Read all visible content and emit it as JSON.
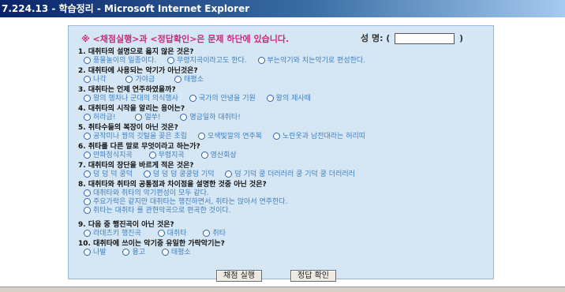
{
  "window": {
    "title": "7.224.13 - 학습정리 - Microsoft Internet Explorer"
  },
  "header": {
    "notice": "※ <채점실행>과 <정답확인>은 문제 하단에 있습니다.",
    "name_label": "성 명: (",
    "name_value": "",
    "name_close": ")"
  },
  "questions": [
    {
      "text": "1. 대취타의 설명으로 옳지 않은 것은?",
      "options": [
        "풍물놀이의 일종이다.",
        "무령지곡이라고도 한다.",
        "부는악기와 치는악기로 편성한다."
      ]
    },
    {
      "text": "2. 대취타에 사용되는 악기가 아닌것은?",
      "options": [
        "나각",
        "가야금",
        "태평소"
      ]
    },
    {
      "text": "3. 대취타는 언제 연주하였을까?",
      "options": [
        "왕의 행차나 군대의 의식행사",
        "국가의 안녕을 기원",
        "왕의 제사때"
      ]
    },
    {
      "text": "4. 대취타의 시작을 알리는 용어는?",
      "options": [
        "허라금!",
        "얼쑤!",
        "명금일하 대취타!"
      ]
    },
    {
      "text": "5. 취타수들의 복장이 아닌 것은?",
      "options": [
        "공작미나 꿩의 깃털을 꽂은 초립",
        "오색빛깔의 연주복",
        "노란옷과 남전대라는 허리띠"
      ]
    },
    {
      "text": "6. 취타를 다른 말로 무엇이라고 하는가?",
      "options": [
        "만파정식지곡",
        "무령지곡",
        "영산회상"
      ]
    },
    {
      "text": "7. 대취타의 장단을 바르게 적은 것은?",
      "options": [
        "덩 덩 덕 쿵덕",
        "덩 덩 덩 쿵쿵덩 기덕",
        "덩 기덕 쿵 더러러러 쿵 기덕 쿵 더러러러"
      ]
    },
    {
      "text": "8. 대취타와 취타의 공통점과 차이점을 설명한 것중 아닌 것은?",
      "options": [
        "대취타와 취타의 악기편성이 모두 같다.",
        "주요가락은 같지만 대취타는 행진하면서, 취타는 앉아서 연주한다.",
        "취타는 대취타 를 관현악곡으로 편곡한 것이다."
      ]
    },
    {
      "text": "9. 다음 중 행진곡이 아닌 것은?",
      "options": [
        "라데츠키 행진곡",
        "대취타",
        "취타"
      ]
    },
    {
      "text": "10. 대취타에 쓰이는 악기중 유일한 가락악기는?",
      "options": [
        "나발",
        "용고",
        "태평소"
      ]
    }
  ],
  "buttons": {
    "grade": "채점 실행",
    "check": "정답 확인"
  }
}
